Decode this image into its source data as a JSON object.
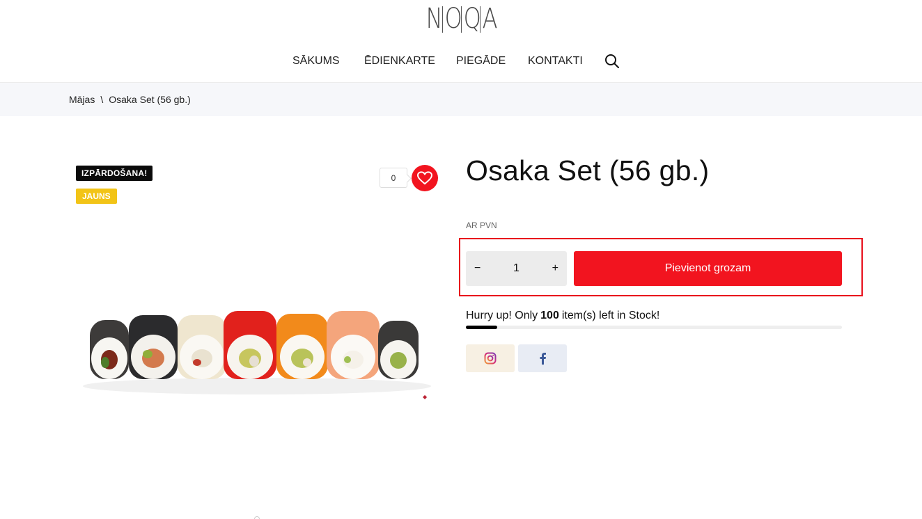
{
  "brand": {
    "logo_letters": [
      "N",
      "O",
      "Q",
      "A"
    ]
  },
  "nav": {
    "items": [
      "SĀKUMS",
      "ĒDIENKARTE",
      "PIEGĀDE",
      "KONTAKTI"
    ],
    "search_icon": "search-icon"
  },
  "breadcrumb": {
    "home": "Mājas",
    "separator": "\\",
    "current": "Osaka Set (56 gb.)"
  },
  "badges": {
    "sale": "IZPĀRDOŠANA!",
    "new": "JAUNS"
  },
  "wishlist": {
    "count": "0",
    "icon": "heart-icon"
  },
  "product": {
    "title": "Osaka Set (56 gb.)",
    "vat_label": "AR PVN",
    "quantity": "1",
    "minus": "−",
    "plus": "+",
    "add_to_cart": "Pievienot grozam"
  },
  "stock": {
    "prefix": "Hurry up! Only",
    "count": "100",
    "suffix": "item(s) left in Stock!",
    "progress_fraction": 0.083
  },
  "share": {
    "instagram_icon": "instagram-icon",
    "facebook_icon": "facebook-icon"
  },
  "colors": {
    "accent": "#f2141f",
    "badge_new": "#f2c417",
    "badge_sale": "#0b0b0b"
  }
}
